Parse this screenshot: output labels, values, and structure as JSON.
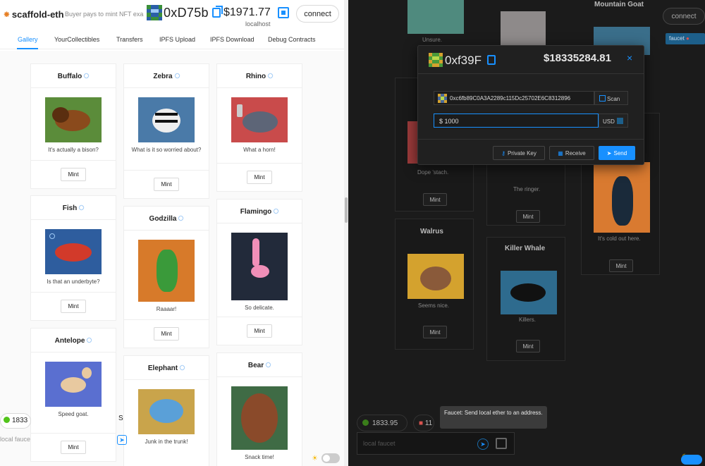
{
  "left": {
    "brand": "scaffold-eth",
    "tagline": "Buyer pays to mint NFT exa",
    "address": "0xD75b",
    "balance": "$1971.77",
    "network": "localhost",
    "connect_label": "connect",
    "tabs": [
      "Gallery",
      "YourCollectibles",
      "Transfers",
      "IPFS Upload",
      "IPFS Download",
      "Debug Contracts"
    ],
    "active_tab": "Gallery",
    "cards": [
      {
        "name": "Buffalo",
        "caption": "It's actually a bison?",
        "art": "buffalo",
        "color": "#5b8c3a",
        "mint": "Mint"
      },
      {
        "name": "Fish",
        "caption": "Is that an underbyte?",
        "art": "fish",
        "color": "#2e5d9e",
        "mint": "Mint"
      },
      {
        "name": "Antelope",
        "caption": "Speed goat.",
        "art": "antelope",
        "color": "#5a6fd0",
        "mint": "Mint"
      },
      {
        "name": "Zebra",
        "caption": "What is it so worried about?",
        "art": "zebra",
        "color": "#4a7aa8",
        "mint": "Mint"
      },
      {
        "name": "Godzilla",
        "caption": "Raaaar!",
        "art": "godzilla",
        "color": "#d77a2a",
        "mint": "Mint"
      },
      {
        "name": "Elephant",
        "caption": "Junk in the trunk!",
        "art": "elephant",
        "color": "#c9a44b",
        "mint": "Mint"
      },
      {
        "name": "Rhino",
        "caption": "What a horn!",
        "art": "rhino",
        "color": "#c94b4b",
        "mint": "Mint"
      },
      {
        "name": "Flamingo",
        "caption": "So delicate.",
        "art": "flamingo",
        "color": "#222a3a",
        "mint": "Mint"
      },
      {
        "name": "Bear",
        "caption": "Snack time!",
        "art": "bear",
        "color": "#3f6b45",
        "mint": ""
      }
    ],
    "bottom_balance": "1833",
    "bottom_balance2": "S",
    "faucet_placeholder": "local fauce"
  },
  "right": {
    "connect_label": "connect",
    "faucet_tag": "faucet",
    "cards": [
      {
        "title": "",
        "caption": "Unsure.",
        "mint": ""
      },
      {
        "title": "Mountain Goat",
        "caption": "",
        "mint": ""
      },
      {
        "title": "",
        "caption": "Dope 'stach.",
        "mint": "Mint"
      },
      {
        "title": "",
        "caption": "The ringer.",
        "mint": "Mint"
      },
      {
        "title": "",
        "caption": "It's cold out here.",
        "mint": "Mint"
      },
      {
        "title": "Walrus",
        "caption": "Seems nice.",
        "mint": "Mint"
      },
      {
        "title": "Killer Whale",
        "caption": "Killers.",
        "mint": "Mint"
      }
    ],
    "balance": "1833.95",
    "balance2": "11",
    "faucet_placeholder": "local faucet",
    "tooltip": "Faucet: Send local ether to an address."
  },
  "modal": {
    "address": "0xf39F",
    "balance": "$18335284.81",
    "close": "×",
    "to_address": "0xc6fb89C0A3A2289c115Dc25702E6C8312896",
    "scan_label": "Scan",
    "amount": "$ 1000",
    "currency": "USD",
    "private_key_label": "Private Key",
    "receive_label": "Receive",
    "send_label": "Send"
  },
  "colors": {
    "accent": "#1890ff",
    "dark_bg": "#1b1b1b",
    "light_bg": "#ffffff"
  }
}
